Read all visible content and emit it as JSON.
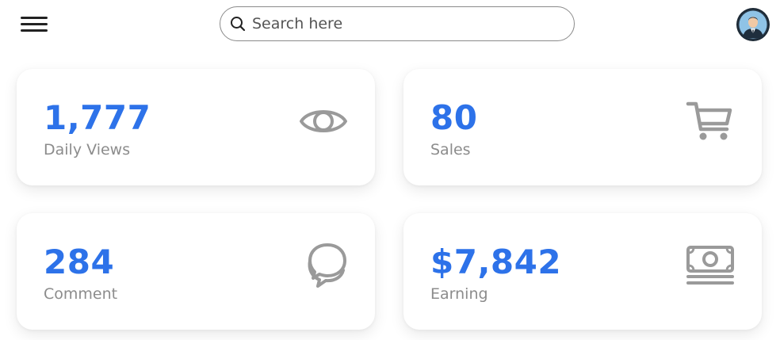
{
  "header": {
    "menu_icon": "hamburger-icon",
    "search": {
      "placeholder": "Search here",
      "value": "",
      "icon": "search-icon"
    },
    "avatar_icon": "user-avatar"
  },
  "cards": [
    {
      "value": "1,777",
      "label": "Daily Views",
      "icon": "eye-icon"
    },
    {
      "value": "80",
      "label": "Sales",
      "icon": "cart-icon"
    },
    {
      "value": "284",
      "label": "Comment",
      "icon": "chat-icon"
    },
    {
      "value": "$7,842",
      "label": "Earning",
      "icon": "cash-icon"
    }
  ],
  "colors": {
    "accent": "#2d72e9",
    "label": "#8c8c8c",
    "icon": "#9a9a9a"
  }
}
